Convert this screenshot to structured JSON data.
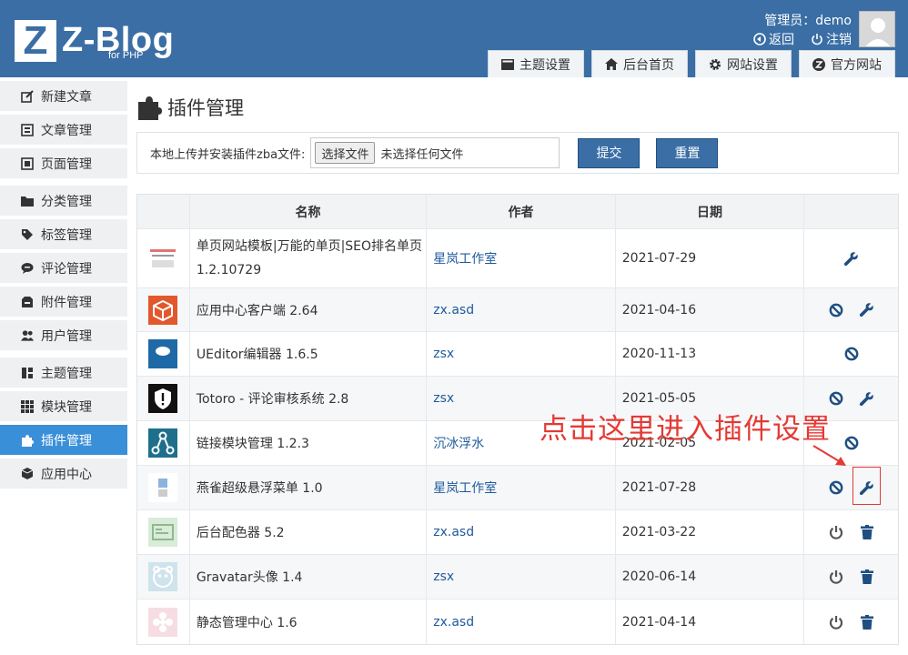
{
  "header": {
    "logo_letter": "Z",
    "logo_text": "Z-Blog",
    "logo_sub": "for PHP",
    "admin_label": "管理员：demo",
    "back_label": "返回",
    "logout_label": "注销",
    "tabs": [
      {
        "label": "主题设置",
        "icon": "theme-icon"
      },
      {
        "label": "后台首页",
        "icon": "home-icon"
      },
      {
        "label": "网站设置",
        "icon": "gear-icon"
      },
      {
        "label": "官方网站",
        "icon": "zblog-icon"
      }
    ]
  },
  "sidebar": {
    "items": [
      {
        "label": "新建文章",
        "icon": "edit-icon"
      },
      {
        "label": "文章管理",
        "icon": "article-icon"
      },
      {
        "label": "页面管理",
        "icon": "page-icon"
      },
      {
        "label": "分类管理",
        "icon": "folder-icon"
      },
      {
        "label": "标签管理",
        "icon": "tag-icon"
      },
      {
        "label": "评论管理",
        "icon": "comment-icon"
      },
      {
        "label": "附件管理",
        "icon": "attachment-icon"
      },
      {
        "label": "用户管理",
        "icon": "users-icon"
      },
      {
        "label": "主题管理",
        "icon": "theme-manage-icon"
      },
      {
        "label": "模块管理",
        "icon": "grid-icon"
      },
      {
        "label": "插件管理",
        "icon": "puzzle-icon",
        "active": true
      },
      {
        "label": "应用中心",
        "icon": "cube-icon"
      }
    ]
  },
  "main": {
    "title": "插件管理",
    "upload": {
      "label": "本地上传并安装插件zba文件:",
      "file_button": "选择文件",
      "file_status": "未选择任何文件",
      "submit": "提交",
      "reset": "重置"
    },
    "table": {
      "columns": [
        "名称",
        "作者",
        "日期"
      ],
      "rows": [
        {
          "name": "单页网站模板|万能的单页|SEO排名单页",
          "name2": "1.2.10729",
          "author": "星岚工作室",
          "date": "2021-07-29",
          "actions": [
            "wrench"
          ],
          "icon": "single-page-icon"
        },
        {
          "name": "应用中心客户端 2.64",
          "name2": "",
          "author": "zx.asd",
          "date": "2021-04-16",
          "actions": [
            "ban",
            "wrench"
          ],
          "icon": "app-center-icon"
        },
        {
          "name": "UEditor编辑器 1.6.5",
          "name2": "",
          "author": "zsx",
          "date": "2020-11-13",
          "actions": [
            "ban"
          ],
          "icon": "ueditor-icon"
        },
        {
          "name": "Totoro - 评论审核系统 2.8",
          "name2": "",
          "author": "zsx",
          "date": "2021-05-05",
          "actions": [
            "ban",
            "wrench"
          ],
          "icon": "totoro-icon"
        },
        {
          "name": "链接模块管理 1.2.3",
          "name2": "",
          "author": "沉冰浮水",
          "date": "2021-02-05",
          "actions": [
            "ban"
          ],
          "icon": "link-module-icon"
        },
        {
          "name": "燕雀超级悬浮菜单 1.0",
          "name2": "",
          "author": "星岚工作室",
          "date": "2021-07-28",
          "actions": [
            "ban",
            "wrench"
          ],
          "icon": "float-menu-icon"
        },
        {
          "name": "后台配色器 5.2",
          "name2": "",
          "author": "zx.asd",
          "date": "2021-03-22",
          "actions": [
            "power",
            "trash"
          ],
          "icon": "color-picker-icon"
        },
        {
          "name": "Gravatar头像 1.4",
          "name2": "",
          "author": "zsx",
          "date": "2020-06-14",
          "actions": [
            "power",
            "trash"
          ],
          "icon": "gravatar-icon"
        },
        {
          "name": "静态管理中心 1.6",
          "name2": "",
          "author": "zx.asd",
          "date": "2021-04-14",
          "actions": [
            "power",
            "trash"
          ],
          "icon": "static-center-icon"
        }
      ]
    }
  },
  "annotation": {
    "text": "点击这里进入插件设置",
    "color": "#e53935"
  },
  "colors": {
    "header": "#3a6ea5",
    "active_sidebar": "#3a8fd9",
    "link": "#1f5a9c"
  }
}
